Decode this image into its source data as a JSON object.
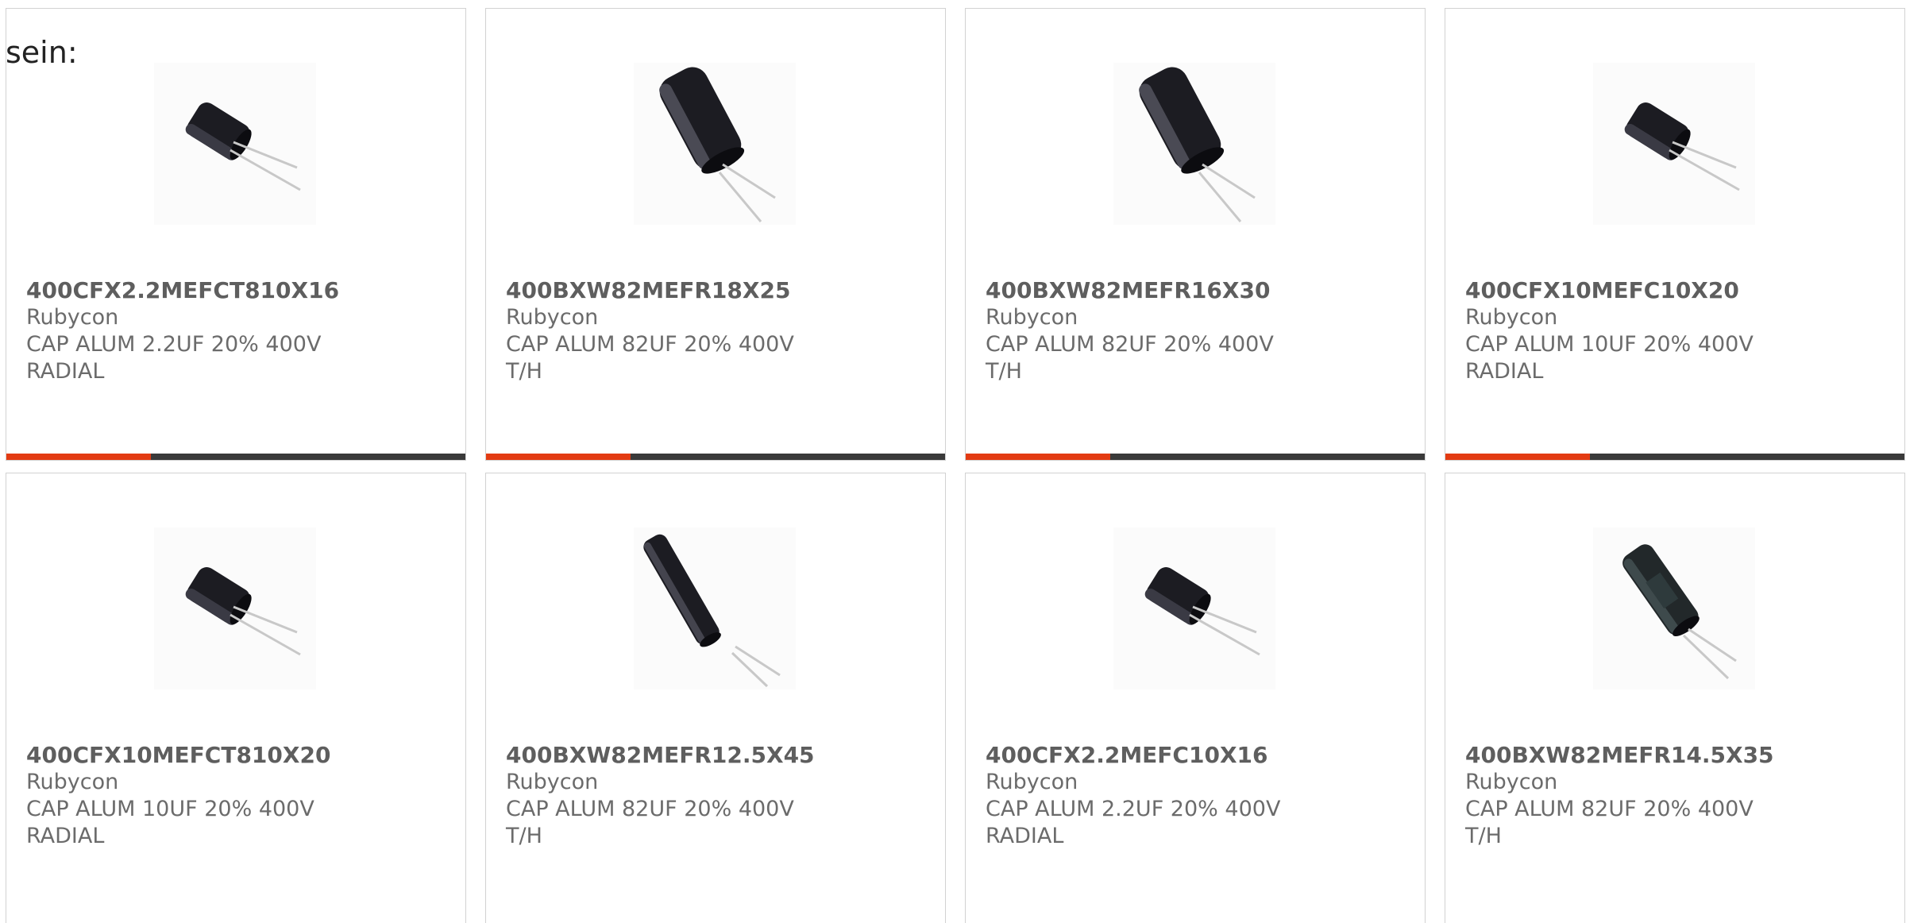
{
  "intro_text": "sein:",
  "accent_color": "#e33b12",
  "bar_color": "#3a3a3a",
  "products": [
    {
      "part": "400CFX2.2MEFCT810X16",
      "maker": "Rubycon",
      "desc": "CAP ALUM 2.2UF 20% 400V RADIAL",
      "image": "capacitor-short-icon"
    },
    {
      "part": "400BXW82MEFR18X25",
      "maker": "Rubycon",
      "desc": "CAP ALUM 82UF 20% 400V T/H",
      "image": "capacitor-large-icon"
    },
    {
      "part": "400BXW82MEFR16X30",
      "maker": "Rubycon",
      "desc": "CAP ALUM 82UF 20% 400V T/H",
      "image": "capacitor-large-icon"
    },
    {
      "part": "400CFX10MEFC10X20",
      "maker": "Rubycon",
      "desc": "CAP ALUM 10UF 20% 400V RADIAL",
      "image": "capacitor-short-icon"
    },
    {
      "part": "400CFX10MEFCT810X20",
      "maker": "Rubycon",
      "desc": "CAP ALUM 10UF 20% 400V RADIAL",
      "image": "capacitor-short-icon"
    },
    {
      "part": "400BXW82MEFR12.5X45",
      "maker": "Rubycon",
      "desc": "CAP ALUM 82UF 20% 400V T/H",
      "image": "capacitor-tall-icon"
    },
    {
      "part": "400CFX2.2MEFC10X16",
      "maker": "Rubycon",
      "desc": "CAP ALUM 2.2UF 20% 400V RADIAL",
      "image": "capacitor-short-icon"
    },
    {
      "part": "400BXW82MEFR14.5X35",
      "maker": "Rubycon",
      "desc": "CAP ALUM 82UF 20% 400V T/H",
      "image": "capacitor-sleeved-icon"
    }
  ]
}
